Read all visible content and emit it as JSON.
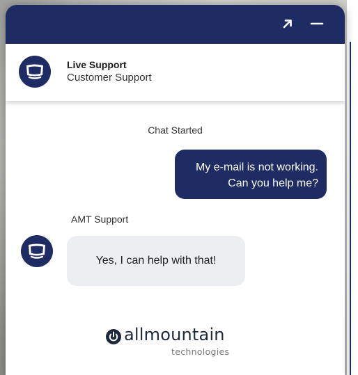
{
  "colors": {
    "primary": "#1f2b63",
    "agent_bubble": "#edeef2",
    "white": "#ffffff"
  },
  "window_controls": {
    "expand_icon": "arrow-up-right-icon",
    "minimize_icon": "minimize-icon"
  },
  "agent": {
    "name": "Live Support",
    "role": "Customer Support",
    "avatar_icon": "monitor-icon"
  },
  "chat": {
    "status": "Chat Started",
    "messages": [
      {
        "from": "user",
        "text": "My e-mail is not working.\nCan you help me?"
      },
      {
        "from": "agent",
        "sender": "AMT Support",
        "text": "Yes, I can help with that!"
      }
    ]
  },
  "branding": {
    "logo_icon": "power-icon",
    "name": "allmountain",
    "tagline": "technologies"
  }
}
